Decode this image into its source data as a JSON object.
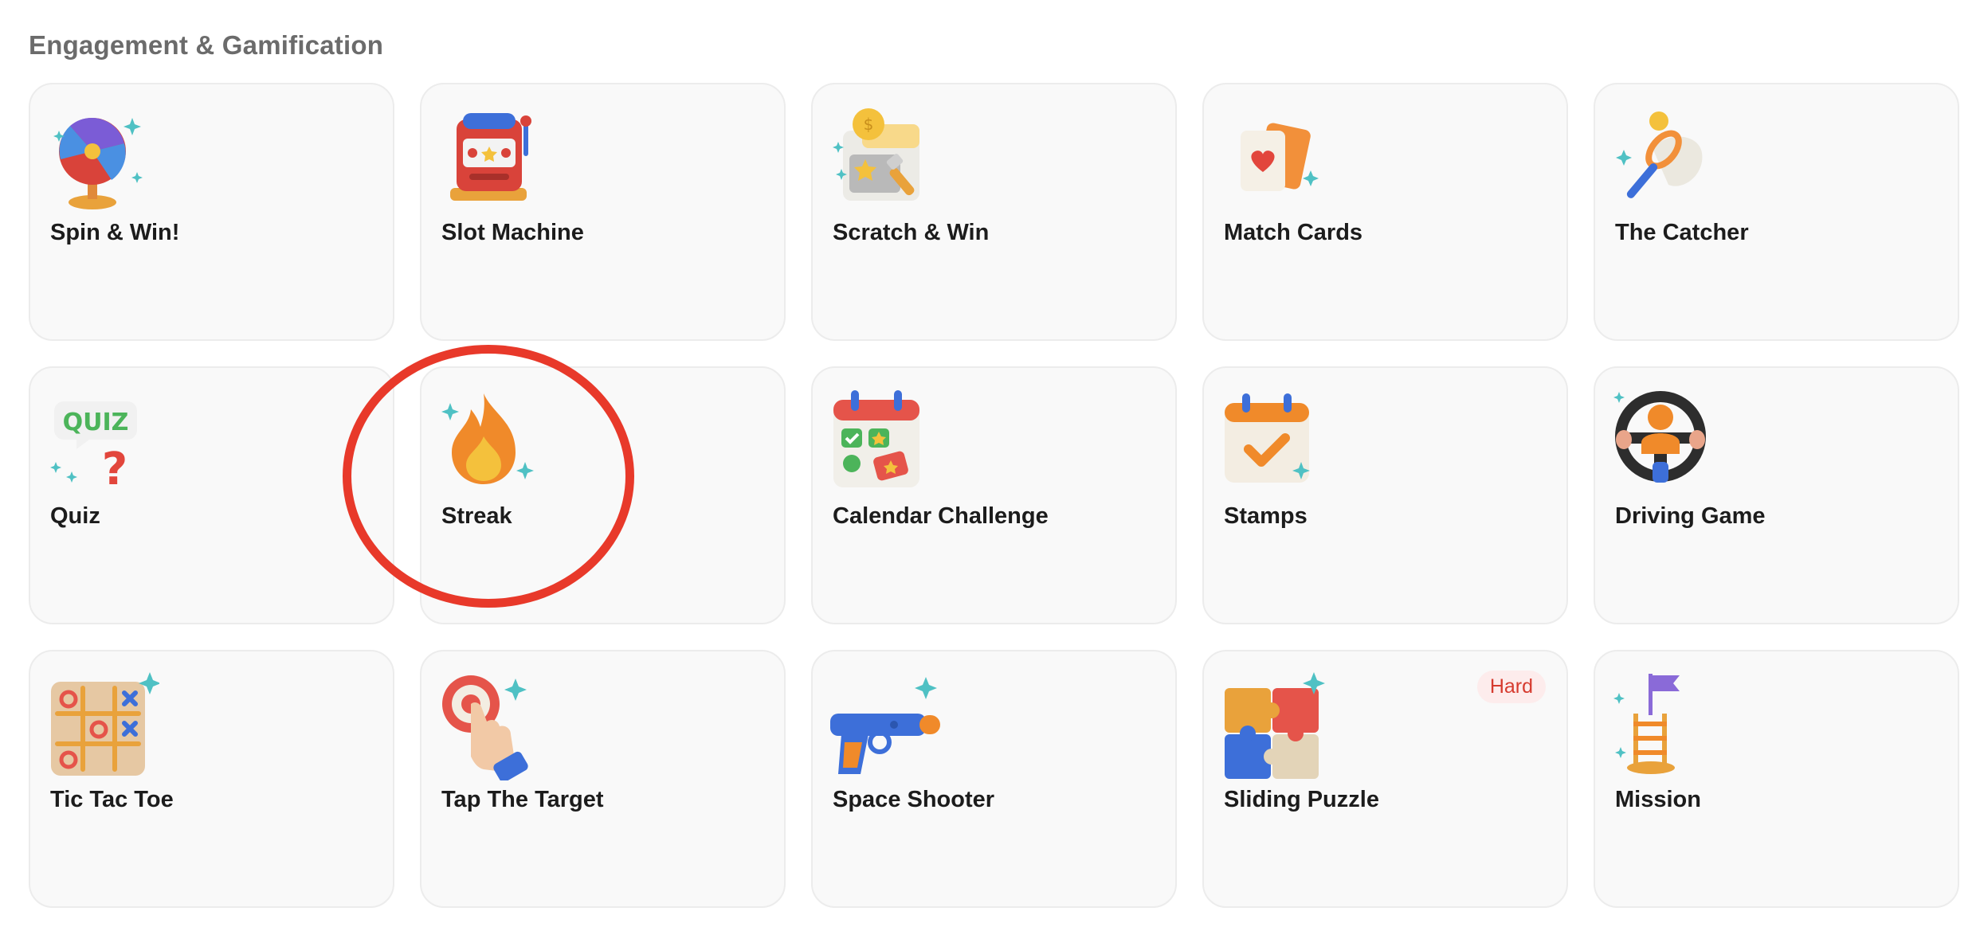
{
  "section": {
    "title": "Engagement & Gamification"
  },
  "cards": [
    {
      "label": "Spin & Win!",
      "icon": "spin-wheel-icon"
    },
    {
      "label": "Slot Machine",
      "icon": "slot-machine-icon"
    },
    {
      "label": "Scratch & Win",
      "icon": "scratch-card-icon"
    },
    {
      "label": "Match Cards",
      "icon": "playing-cards-icon"
    },
    {
      "label": "The Catcher",
      "icon": "catcher-net-icon"
    },
    {
      "label": "Quiz",
      "icon": "quiz-bubble-icon"
    },
    {
      "label": "Streak",
      "icon": "flame-icon"
    },
    {
      "label": "Calendar Challenge",
      "icon": "calendar-challenge-icon"
    },
    {
      "label": "Stamps",
      "icon": "stamp-calendar-icon"
    },
    {
      "label": "Driving Game",
      "icon": "steering-wheel-icon"
    },
    {
      "label": "Tic Tac Toe",
      "icon": "tic-tac-toe-icon"
    },
    {
      "label": "Tap The Target",
      "icon": "tap-target-icon"
    },
    {
      "label": "Space Shooter",
      "icon": "ray-gun-icon"
    },
    {
      "label": "Sliding Puzzle",
      "icon": "puzzle-icon",
      "badge": "Hard"
    },
    {
      "label": "Mission",
      "icon": "mission-flag-icon"
    }
  ],
  "colors": {
    "card_background": "#f9f9f9",
    "card_border": "#ececec",
    "title_text": "#6b6b6b",
    "label_text": "#1c1c1c",
    "badge_text": "#d63b2f",
    "badge_background": "#fdecec",
    "highlight_ring": "#e8392a"
  },
  "highlight": {
    "target": "Streak",
    "shape": "red hand-drawn ellipse"
  }
}
